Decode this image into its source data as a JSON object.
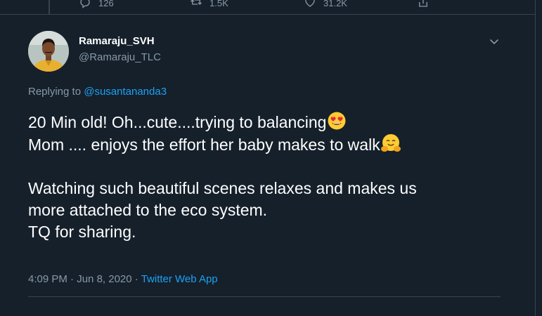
{
  "top_actions": {
    "reply_count": "126",
    "retweet_count": "1.5K",
    "like_count": "31.2K"
  },
  "tweet": {
    "display_name": "Ramaraju_SVH",
    "handle": "@Ramaraju_TLC",
    "replying_prefix": "Replying to",
    "replying_to": "@susantananda3",
    "lines": [
      "20 Min old! Oh...cute....trying to balancing",
      "Mom .... enjoys the effort her baby makes to walk",
      "Watching such beautiful scenes relaxes and makes us",
      "more attached to the eco system.",
      "TQ for sharing."
    ],
    "emojis": [
      "smiling-face-with-heart-eyes",
      "hugging-face"
    ],
    "time": "4:09 PM",
    "date": "Jun 8, 2020",
    "separator": "·",
    "app": "Twitter Web App"
  },
  "colors": {
    "background": "#15202b",
    "border": "#38444d",
    "secondary_text": "#8899a6",
    "link": "#1da1f2"
  }
}
